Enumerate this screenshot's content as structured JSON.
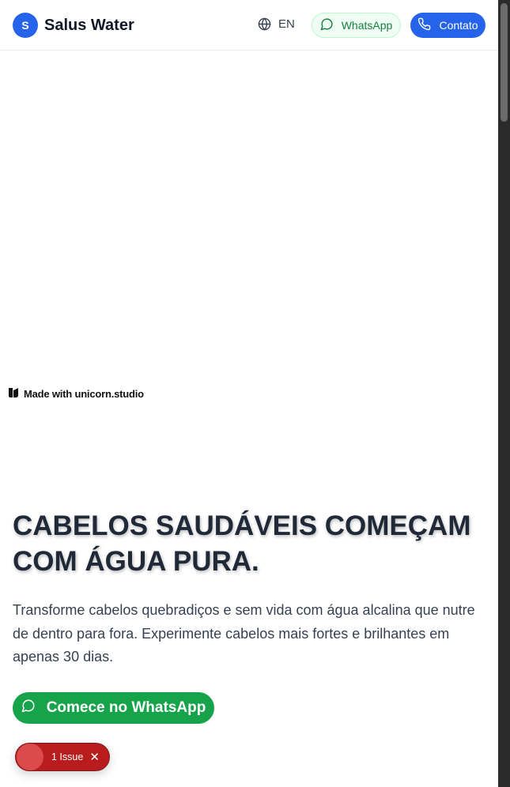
{
  "header": {
    "logo_letter": "S",
    "brand": "Salus Water",
    "language": "EN",
    "whatsapp_label": "WhatsApp",
    "contact_label": "Contato"
  },
  "badge": {
    "made_with": "Made with unicorn.studio"
  },
  "hero": {
    "title": "CABELOS SAUDÁVEIS COMEÇAM COM ÁGUA PURA.",
    "subtitle": "Transforme cabelos quebradiços e sem vida com água alcalina que nutre de dentro para fora. Experimente cabelos mais fortes e brilhantes em apenas 30 dias.",
    "cta_label": "Comece no WhatsApp"
  },
  "issue_indicator": {
    "label": "1 Issue"
  },
  "colors": {
    "primary": "#2563eb",
    "whatsapp_green": "#16a34a",
    "issue_red": "#b91c1c"
  },
  "icons": {
    "language": "globe-icon",
    "whatsapp": "chat-bubble-icon",
    "contact": "phone-icon",
    "close": "close-icon"
  }
}
